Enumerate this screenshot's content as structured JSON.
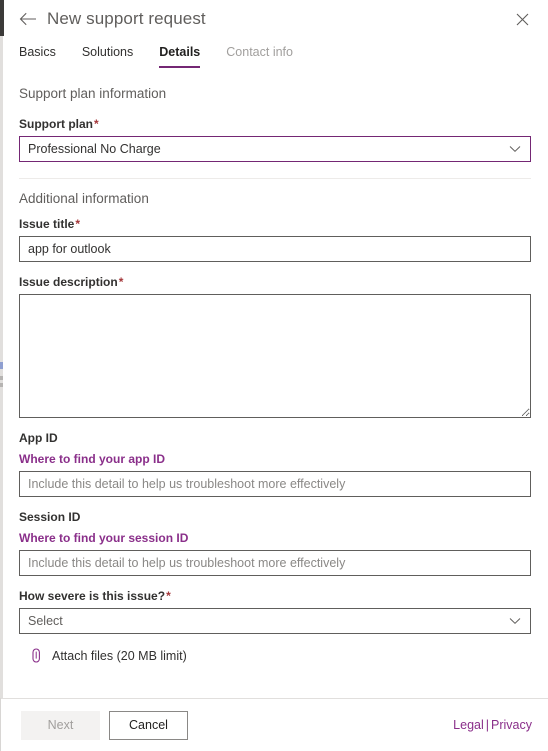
{
  "header": {
    "title": "New support request",
    "back_icon": "back-arrow-icon",
    "close_icon": "close-icon"
  },
  "tabs": [
    {
      "label": "Basics",
      "state": "normal"
    },
    {
      "label": "Solutions",
      "state": "normal"
    },
    {
      "label": "Details",
      "state": "active"
    },
    {
      "label": "Contact info",
      "state": "disabled"
    }
  ],
  "sections": {
    "support_plan_title": "Support plan information",
    "additional_title": "Additional information"
  },
  "fields": {
    "support_plan": {
      "label": "Support plan",
      "required": "*",
      "value": "Professional No Charge",
      "chevron_icon": "chevron-down-icon"
    },
    "issue_title": {
      "label": "Issue title",
      "required": "*",
      "value": "app for outlook",
      "placeholder": ""
    },
    "issue_description": {
      "label": "Issue description",
      "required": "*",
      "value": "",
      "placeholder": ""
    },
    "app_id": {
      "label": "App ID",
      "link": "Where to find your app ID",
      "placeholder": "Include this detail to help us troubleshoot more effectively",
      "value": ""
    },
    "session_id": {
      "label": "Session ID",
      "link": "Where to find your session ID",
      "placeholder": "Include this detail to help us troubleshoot more effectively",
      "value": ""
    },
    "severity": {
      "label": "How severe is this issue?",
      "required": "*",
      "value": "Select",
      "chevron_icon": "chevron-down-icon"
    }
  },
  "attach": {
    "label": "Attach files (20 MB limit)",
    "icon": "paperclip-icon"
  },
  "footer": {
    "next_label": "Next",
    "cancel_label": "Cancel",
    "legal_label": "Legal",
    "separator": "|",
    "privacy_label": "Privacy"
  },
  "colors": {
    "accent_purple": "#742774",
    "link_purple": "#8a2f8a",
    "required_red": "#a4373a",
    "border_gray": "#605e5c",
    "muted_text": "#605e5c"
  }
}
